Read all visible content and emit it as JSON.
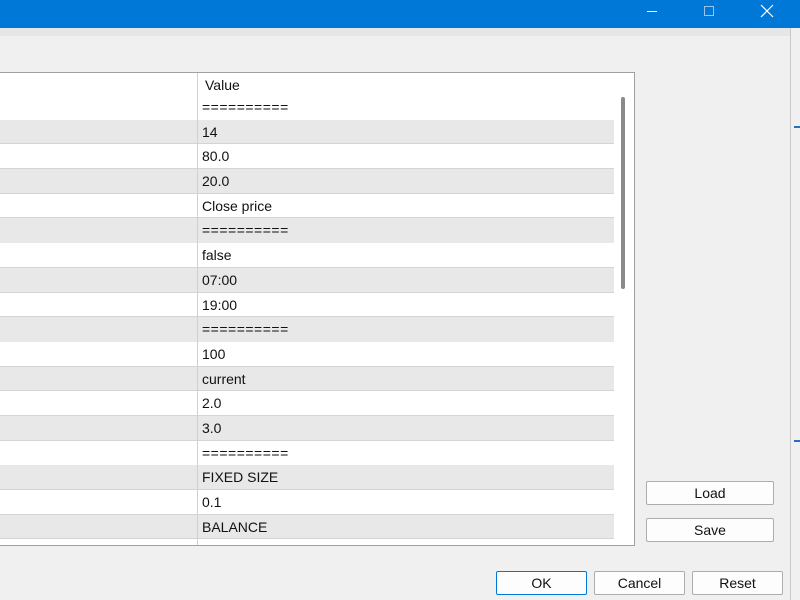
{
  "window": {
    "minimize_icon": "minimize-icon",
    "maximize_icon": "maximize-icon",
    "close_icon": "close-icon",
    "accent_color": "#0078d7"
  },
  "grid": {
    "header": {
      "value": "Value"
    },
    "rows": [
      {
        "value": "==========",
        "separator": true
      },
      {
        "value": "14"
      },
      {
        "value": "80.0"
      },
      {
        "value": "20.0"
      },
      {
        "value": "Close price"
      },
      {
        "value": "==========",
        "separator": true
      },
      {
        "value": "false"
      },
      {
        "value": "07:00"
      },
      {
        "value": "19:00"
      },
      {
        "value": "==========",
        "separator": true
      },
      {
        "value": "100"
      },
      {
        "value": "current"
      },
      {
        "value": "2.0"
      },
      {
        "value": "3.0"
      },
      {
        "value": "==========",
        "separator": true
      },
      {
        "value": "FIXED SIZE"
      },
      {
        "value": "0.1"
      },
      {
        "value": "BALANCE"
      }
    ]
  },
  "side_buttons": {
    "load": "Load",
    "save": "Save"
  },
  "bottom_buttons": {
    "ok": "OK",
    "cancel": "Cancel",
    "reset": "Reset"
  }
}
